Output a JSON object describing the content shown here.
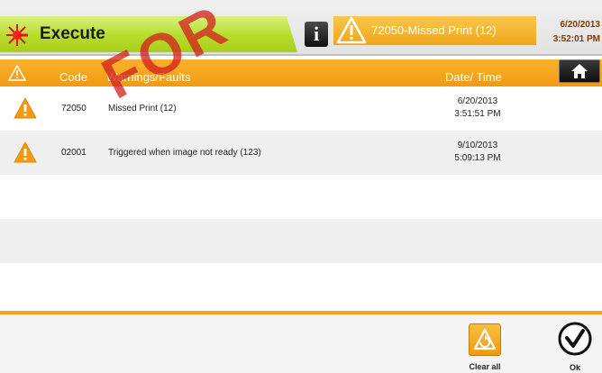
{
  "header": {
    "title": "Execute",
    "title_icon": "laser-burst-icon",
    "info_label": "i",
    "alarm_text": "72050-Missed Print (12)",
    "date": "6/20/2013",
    "time": "3:52:01 PM"
  },
  "table": {
    "columns": {
      "code": "Code",
      "description": "Warnings/Faults",
      "datetime": "Date/ Time"
    },
    "rows": [
      {
        "code": "72050",
        "description": "Missed Print (12)",
        "date": "6/20/2013",
        "time": "3:51:51 PM",
        "icon": "warning-triangle-icon"
      },
      {
        "code": "02001",
        "description": "Triggered when image not ready (123)",
        "date": "9/10/2013",
        "time": "5:09:13 PM",
        "icon": "warning-triangle-icon"
      },
      {
        "code": "",
        "description": "",
        "date": "",
        "time": ""
      },
      {
        "code": "",
        "description": "",
        "date": "",
        "time": ""
      },
      {
        "code": "",
        "description": "",
        "date": "",
        "time": ""
      }
    ]
  },
  "footer": {
    "clear_all_label": "Clear all",
    "ok_label": "Ok"
  },
  "watermark": "FOR",
  "colors": {
    "accent_orange": "#f29a12",
    "title_green": "#b7dc2a",
    "watermark_red": "#d21e1e"
  }
}
